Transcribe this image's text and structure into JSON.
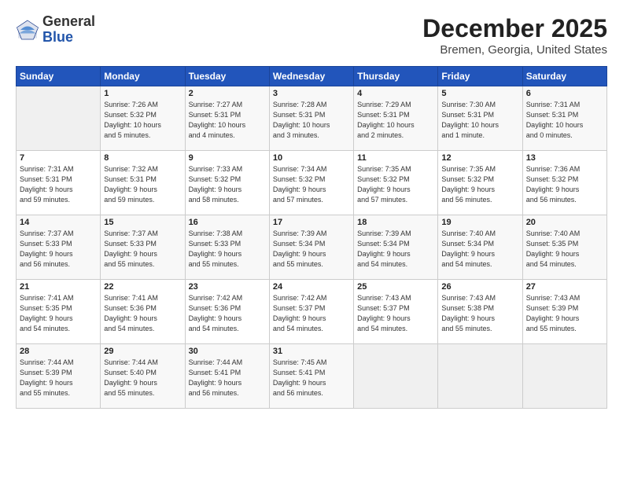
{
  "header": {
    "logo": {
      "general": "General",
      "blue": "Blue"
    },
    "title": "December 2025",
    "location": "Bremen, Georgia, United States"
  },
  "days_of_week": [
    "Sunday",
    "Monday",
    "Tuesday",
    "Wednesday",
    "Thursday",
    "Friday",
    "Saturday"
  ],
  "weeks": [
    [
      {
        "day": "",
        "info": ""
      },
      {
        "day": "1",
        "info": "Sunrise: 7:26 AM\nSunset: 5:32 PM\nDaylight: 10 hours\nand 5 minutes."
      },
      {
        "day": "2",
        "info": "Sunrise: 7:27 AM\nSunset: 5:31 PM\nDaylight: 10 hours\nand 4 minutes."
      },
      {
        "day": "3",
        "info": "Sunrise: 7:28 AM\nSunset: 5:31 PM\nDaylight: 10 hours\nand 3 minutes."
      },
      {
        "day": "4",
        "info": "Sunrise: 7:29 AM\nSunset: 5:31 PM\nDaylight: 10 hours\nand 2 minutes."
      },
      {
        "day": "5",
        "info": "Sunrise: 7:30 AM\nSunset: 5:31 PM\nDaylight: 10 hours\nand 1 minute."
      },
      {
        "day": "6",
        "info": "Sunrise: 7:31 AM\nSunset: 5:31 PM\nDaylight: 10 hours\nand 0 minutes."
      }
    ],
    [
      {
        "day": "7",
        "info": "Sunrise: 7:31 AM\nSunset: 5:31 PM\nDaylight: 9 hours\nand 59 minutes."
      },
      {
        "day": "8",
        "info": "Sunrise: 7:32 AM\nSunset: 5:31 PM\nDaylight: 9 hours\nand 59 minutes."
      },
      {
        "day": "9",
        "info": "Sunrise: 7:33 AM\nSunset: 5:32 PM\nDaylight: 9 hours\nand 58 minutes."
      },
      {
        "day": "10",
        "info": "Sunrise: 7:34 AM\nSunset: 5:32 PM\nDaylight: 9 hours\nand 57 minutes."
      },
      {
        "day": "11",
        "info": "Sunrise: 7:35 AM\nSunset: 5:32 PM\nDaylight: 9 hours\nand 57 minutes."
      },
      {
        "day": "12",
        "info": "Sunrise: 7:35 AM\nSunset: 5:32 PM\nDaylight: 9 hours\nand 56 minutes."
      },
      {
        "day": "13",
        "info": "Sunrise: 7:36 AM\nSunset: 5:32 PM\nDaylight: 9 hours\nand 56 minutes."
      }
    ],
    [
      {
        "day": "14",
        "info": "Sunrise: 7:37 AM\nSunset: 5:33 PM\nDaylight: 9 hours\nand 56 minutes."
      },
      {
        "day": "15",
        "info": "Sunrise: 7:37 AM\nSunset: 5:33 PM\nDaylight: 9 hours\nand 55 minutes."
      },
      {
        "day": "16",
        "info": "Sunrise: 7:38 AM\nSunset: 5:33 PM\nDaylight: 9 hours\nand 55 minutes."
      },
      {
        "day": "17",
        "info": "Sunrise: 7:39 AM\nSunset: 5:34 PM\nDaylight: 9 hours\nand 55 minutes."
      },
      {
        "day": "18",
        "info": "Sunrise: 7:39 AM\nSunset: 5:34 PM\nDaylight: 9 hours\nand 54 minutes."
      },
      {
        "day": "19",
        "info": "Sunrise: 7:40 AM\nSunset: 5:34 PM\nDaylight: 9 hours\nand 54 minutes."
      },
      {
        "day": "20",
        "info": "Sunrise: 7:40 AM\nSunset: 5:35 PM\nDaylight: 9 hours\nand 54 minutes."
      }
    ],
    [
      {
        "day": "21",
        "info": "Sunrise: 7:41 AM\nSunset: 5:35 PM\nDaylight: 9 hours\nand 54 minutes."
      },
      {
        "day": "22",
        "info": "Sunrise: 7:41 AM\nSunset: 5:36 PM\nDaylight: 9 hours\nand 54 minutes."
      },
      {
        "day": "23",
        "info": "Sunrise: 7:42 AM\nSunset: 5:36 PM\nDaylight: 9 hours\nand 54 minutes."
      },
      {
        "day": "24",
        "info": "Sunrise: 7:42 AM\nSunset: 5:37 PM\nDaylight: 9 hours\nand 54 minutes."
      },
      {
        "day": "25",
        "info": "Sunrise: 7:43 AM\nSunset: 5:37 PM\nDaylight: 9 hours\nand 54 minutes."
      },
      {
        "day": "26",
        "info": "Sunrise: 7:43 AM\nSunset: 5:38 PM\nDaylight: 9 hours\nand 55 minutes."
      },
      {
        "day": "27",
        "info": "Sunrise: 7:43 AM\nSunset: 5:39 PM\nDaylight: 9 hours\nand 55 minutes."
      }
    ],
    [
      {
        "day": "28",
        "info": "Sunrise: 7:44 AM\nSunset: 5:39 PM\nDaylight: 9 hours\nand 55 minutes."
      },
      {
        "day": "29",
        "info": "Sunrise: 7:44 AM\nSunset: 5:40 PM\nDaylight: 9 hours\nand 55 minutes."
      },
      {
        "day": "30",
        "info": "Sunrise: 7:44 AM\nSunset: 5:41 PM\nDaylight: 9 hours\nand 56 minutes."
      },
      {
        "day": "31",
        "info": "Sunrise: 7:45 AM\nSunset: 5:41 PM\nDaylight: 9 hours\nand 56 minutes."
      },
      {
        "day": "",
        "info": ""
      },
      {
        "day": "",
        "info": ""
      },
      {
        "day": "",
        "info": ""
      }
    ]
  ]
}
